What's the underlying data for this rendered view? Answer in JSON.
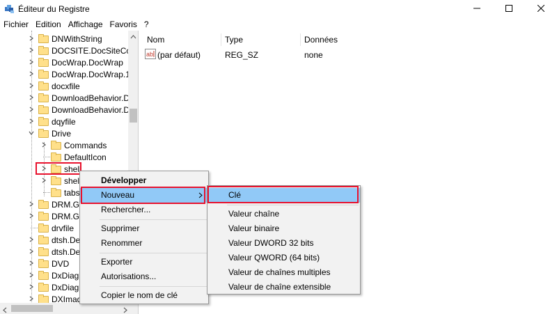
{
  "window": {
    "title": "Éditeur du Registre",
    "controls": [
      "minimize-icon",
      "maximize-icon",
      "close-icon"
    ]
  },
  "menubar": [
    "Fichier",
    "Edition",
    "Affichage",
    "Favoris",
    "?"
  ],
  "tree": {
    "items": [
      {
        "label": "DNWithString",
        "expandable": true
      },
      {
        "label": "DOCSITE.DocSiteCont",
        "expandable": true
      },
      {
        "label": "DocWrap.DocWrap",
        "expandable": true
      },
      {
        "label": "DocWrap.DocWrap.1",
        "expandable": true
      },
      {
        "label": "docxfile",
        "expandable": true
      },
      {
        "label": "DownloadBehavior.Do",
        "expandable": true
      },
      {
        "label": "DownloadBehavior.Do",
        "expandable": true
      },
      {
        "label": "dqyfile",
        "expandable": true
      },
      {
        "label": "Drive",
        "expandable": true,
        "expanded": true
      },
      {
        "label": "Commands",
        "expandable": true
      },
      {
        "label": "DefaultIcon",
        "expandable": false
      },
      {
        "label": "shell",
        "expandable": true,
        "highlighted": true
      },
      {
        "label": "shel",
        "expandable": true
      },
      {
        "label": "tabs",
        "expandable": false
      },
      {
        "label": "DRM.Ge",
        "expandable": true
      },
      {
        "label": "DRM.Ge",
        "expandable": true
      },
      {
        "label": "drvfile",
        "expandable": false
      },
      {
        "label": "dtsh.De",
        "expandable": true
      },
      {
        "label": "dtsh.De",
        "expandable": true
      },
      {
        "label": "DVD",
        "expandable": true
      },
      {
        "label": "DxDiag.",
        "expandable": true
      },
      {
        "label": "DxDiag.",
        "expandable": true
      },
      {
        "label": "DXImag",
        "expandable": true
      }
    ]
  },
  "list": {
    "columns": [
      "Nom",
      "Type",
      "Données"
    ],
    "rows": [
      {
        "name": "(par défaut)",
        "type": "REG_SZ",
        "data": "none",
        "icon": "string-value-icon"
      }
    ]
  },
  "context_menu": {
    "items": [
      "Développer",
      "Nouveau",
      "Rechercher...",
      "Supprimer",
      "Renommer",
      "Exporter",
      "Autorisations...",
      "Copier le nom de clé"
    ],
    "bold_item": "Développer",
    "highlighted_item": "Nouveau"
  },
  "submenu": {
    "items": [
      "Clé",
      "Valeur chaîne",
      "Valeur binaire",
      "Valeur DWORD 32 bits",
      "Valeur QWORD (64 bits)",
      "Valeur de chaînes multiples",
      "Valeur de chaîne extensible"
    ],
    "highlighted_item": "Clé"
  },
  "colors": {
    "highlight": "#91c9f7",
    "annotation_red": "#e8112d",
    "folder": "#ffe08a"
  }
}
